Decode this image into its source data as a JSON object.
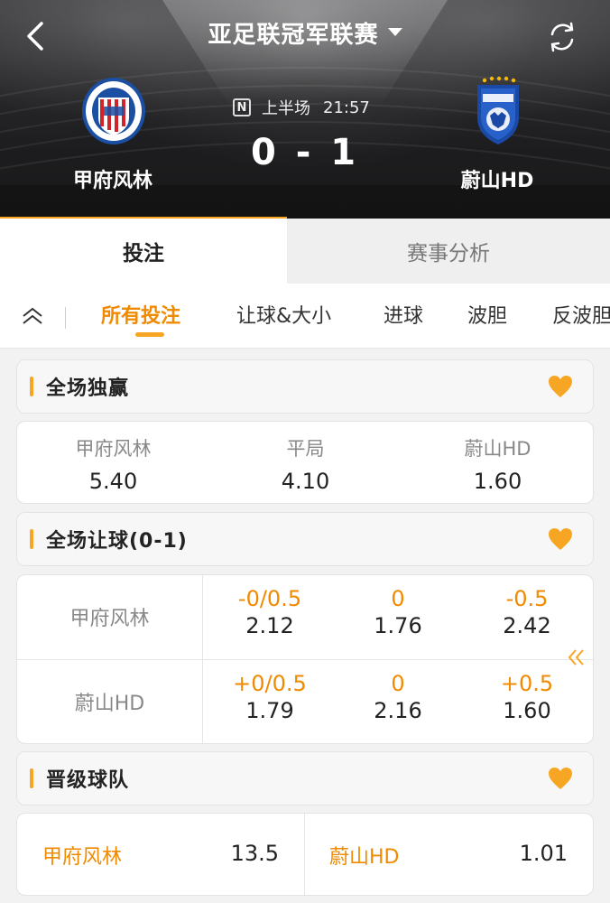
{
  "header": {
    "title": "亚足联冠军联赛",
    "status": {
      "badge": "N",
      "half": "上半场",
      "clock": "21:57"
    },
    "score": "0 - 1",
    "home_team": "甲府风林",
    "away_team": "蔚山HD"
  },
  "main_tabs": [
    {
      "label": "投注",
      "active": true
    },
    {
      "label": "赛事分析",
      "active": false
    }
  ],
  "sub_tabs": [
    {
      "label": "所有投注",
      "active": true
    },
    {
      "label": "让球&大小",
      "active": false
    },
    {
      "label": "进球",
      "active": false
    },
    {
      "label": "波胆",
      "active": false
    },
    {
      "label": "反波胆",
      "active": false
    }
  ],
  "sections": {
    "match_winner": {
      "title": "全场独赢",
      "options": [
        {
          "label": "甲府风林",
          "odds": "5.40"
        },
        {
          "label": "平局",
          "odds": "4.10"
        },
        {
          "label": "蔚山HD",
          "odds": "1.60"
        }
      ]
    },
    "handicap": {
      "title": "全场让球(0-1)",
      "rows": [
        {
          "team": "甲府风林",
          "lines": [
            {
              "hcp": "-0/0.5",
              "odds": "2.12"
            },
            {
              "hcp": "0",
              "odds": "1.76"
            },
            {
              "hcp": "-0.5",
              "odds": "2.42"
            }
          ]
        },
        {
          "team": "蔚山HD",
          "lines": [
            {
              "hcp": "+0/0.5",
              "odds": "1.79"
            },
            {
              "hcp": "0",
              "odds": "2.16"
            },
            {
              "hcp": "+0.5",
              "odds": "1.60"
            }
          ]
        }
      ]
    },
    "qualify": {
      "title": "晋级球队",
      "options": [
        {
          "team": "甲府风林",
          "odds": "13.5"
        },
        {
          "team": "蔚山HD",
          "odds": "1.01"
        }
      ]
    }
  },
  "colors": {
    "accent": "#f6a623",
    "accent_text": "#f08a00",
    "header_bg": "#1e1e20"
  }
}
